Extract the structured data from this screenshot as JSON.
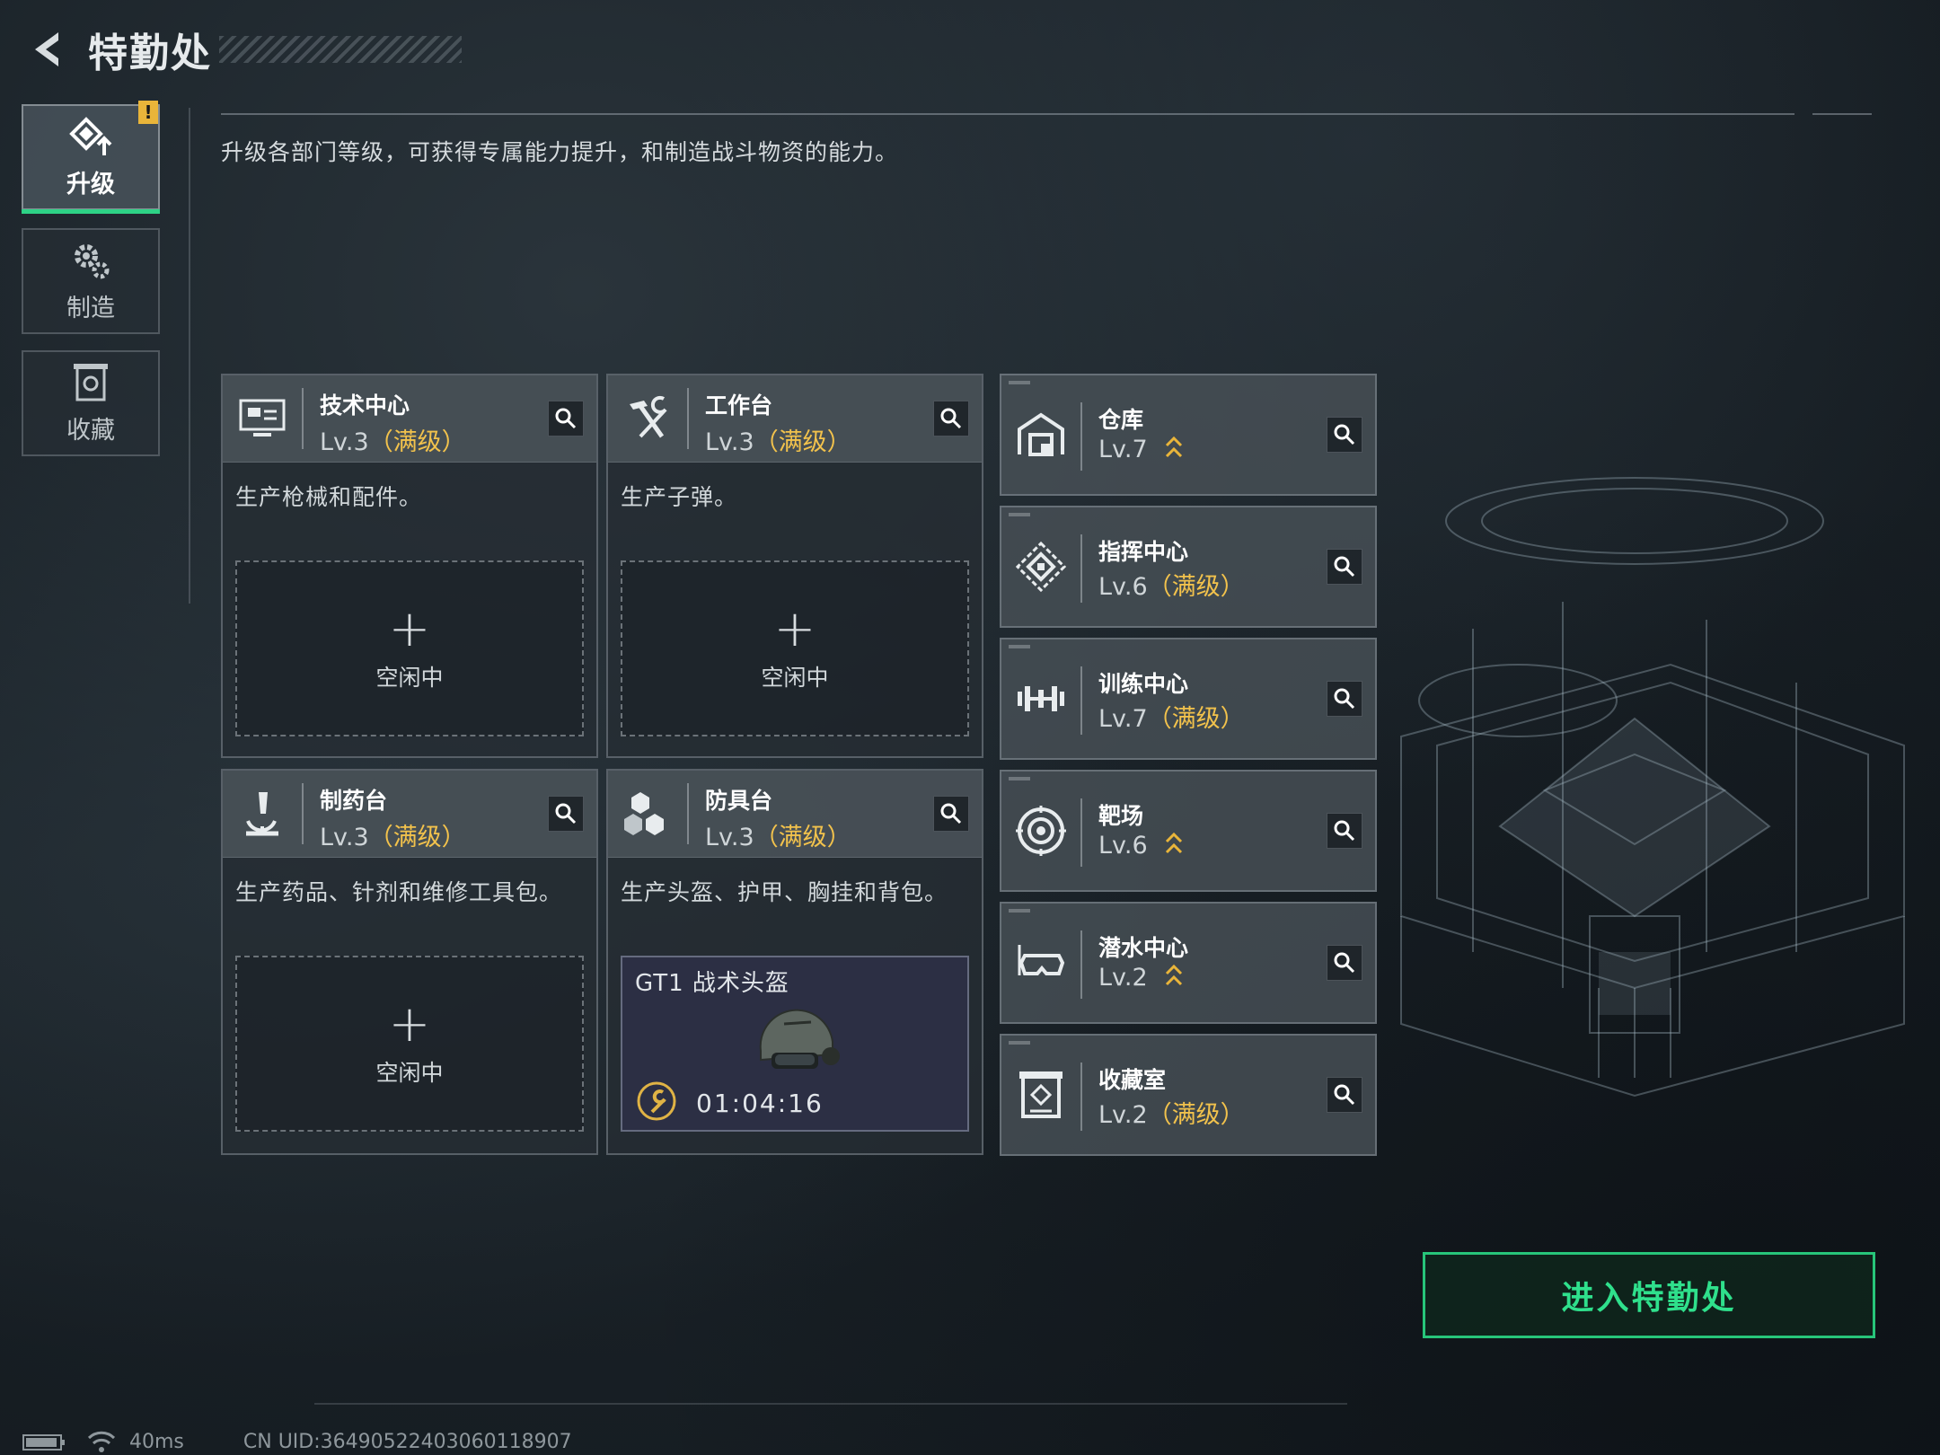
{
  "header": {
    "title": "特勤处"
  },
  "intro": "升级各部门等级，可获得专属能力提升，和制造战斗物资的能力。",
  "nav": [
    {
      "label": "升级",
      "icon": "upgrade-icon",
      "active": true,
      "alert": "!"
    },
    {
      "label": "制造",
      "icon": "gears-icon",
      "active": false
    },
    {
      "label": "收藏",
      "icon": "collection-icon",
      "active": false
    }
  ],
  "workstations": [
    {
      "name": "技术中心",
      "level": "Lv.3",
      "maxed": "（满级）",
      "desc": "生产枪械和配件。",
      "icon": "monitor-icon",
      "slot": {
        "plus": "+",
        "label": "空闲中"
      }
    },
    {
      "name": "工作台",
      "level": "Lv.3",
      "maxed": "（满级）",
      "desc": "生产子弹。",
      "icon": "hammer-wrench-icon",
      "slot": {
        "plus": "+",
        "label": "空闲中"
      }
    },
    {
      "name": "制药台",
      "level": "Lv.3",
      "maxed": "（满级）",
      "desc": "生产药品、针剂和维修工具包。",
      "icon": "microscope-icon",
      "slot": {
        "plus": "+",
        "label": "空闲中"
      }
    },
    {
      "name": "防具台",
      "level": "Lv.3",
      "maxed": "（满级）",
      "desc": "生产头盔、护甲、胸挂和背包。",
      "icon": "armor-boxes-icon",
      "craft": {
        "item": "GT1 战术头盔",
        "timer": "01:04:16"
      }
    }
  ],
  "facilities": [
    {
      "name": "仓库",
      "level": "Lv.7",
      "maxed": "",
      "upgradable": true,
      "icon": "warehouse-icon"
    },
    {
      "name": "指挥中心",
      "level": "Lv.6",
      "maxed": "（满级）",
      "upgradable": false,
      "icon": "command-icon"
    },
    {
      "name": "训练中心",
      "level": "Lv.7",
      "maxed": "（满级）",
      "upgradable": false,
      "icon": "dumbbell-icon"
    },
    {
      "name": "靶场",
      "level": "Lv.6",
      "maxed": "",
      "upgradable": true,
      "icon": "target-icon"
    },
    {
      "name": "潜水中心",
      "level": "Lv.2",
      "maxed": "",
      "upgradable": true,
      "icon": "diving-mask-icon"
    },
    {
      "name": "收藏室",
      "level": "Lv.2",
      "maxed": "（满级）",
      "upgradable": false,
      "icon": "collection-room-icon"
    }
  ],
  "enter_button": "进入特勤处",
  "status": {
    "ping": "40ms",
    "uid": "CN UID:36490522403060118907"
  },
  "colors": {
    "accent_green": "#2ed286",
    "maxed_gold": "#f2c24c",
    "upgrade_gold": "#e9b53a"
  }
}
